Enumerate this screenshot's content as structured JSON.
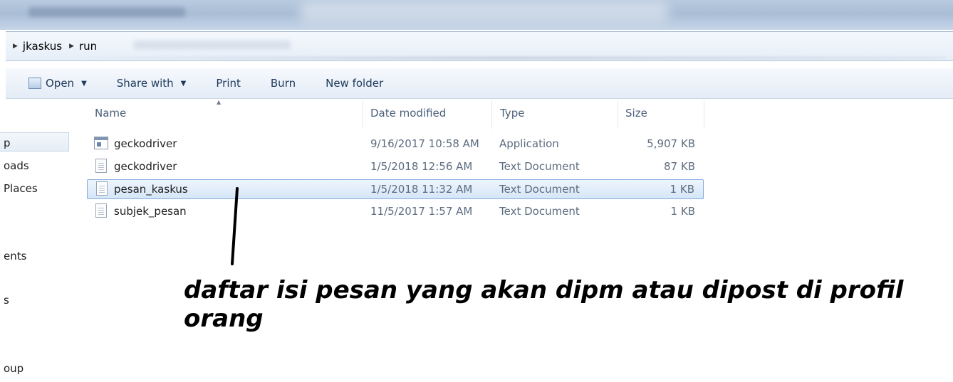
{
  "breadcrumb": [
    "jkaskus",
    "run"
  ],
  "toolbar": {
    "open_label": "Open",
    "share_label": "Share with",
    "print_label": "Print",
    "burn_label": "Burn",
    "new_folder_label": "New folder"
  },
  "sidebar": {
    "items": [
      "p",
      "oads",
      " Places",
      "ents",
      "s",
      "oup"
    ]
  },
  "columns": {
    "name": "Name",
    "date": "Date modified",
    "type": "Type",
    "size": "Size"
  },
  "files": [
    {
      "name": "geckodriver",
      "date": "9/16/2017 10:58 AM",
      "type": "Application",
      "size": "5,907 KB",
      "icon": "application-icon",
      "selected": false
    },
    {
      "name": "geckodriver",
      "date": "1/5/2018 12:56 AM",
      "type": "Text Document",
      "size": "87 KB",
      "icon": "text-document-icon",
      "selected": false
    },
    {
      "name": "pesan_kaskus",
      "date": "1/5/2018 11:32 AM",
      "type": "Text Document",
      "size": "1 KB",
      "icon": "text-document-icon",
      "selected": true
    },
    {
      "name": "subjek_pesan",
      "date": "11/5/2017 1:57 AM",
      "type": "Text Document",
      "size": "1 KB",
      "icon": "text-document-icon",
      "selected": false
    }
  ],
  "annotation": {
    "line1": "daftar isi pesan yang akan dipm atau dipost di profil",
    "line2": "orang"
  },
  "colors": {
    "selection": "#d5e6f8",
    "selection_border": "#84acdd",
    "toolbar_text": "#1e395b"
  }
}
